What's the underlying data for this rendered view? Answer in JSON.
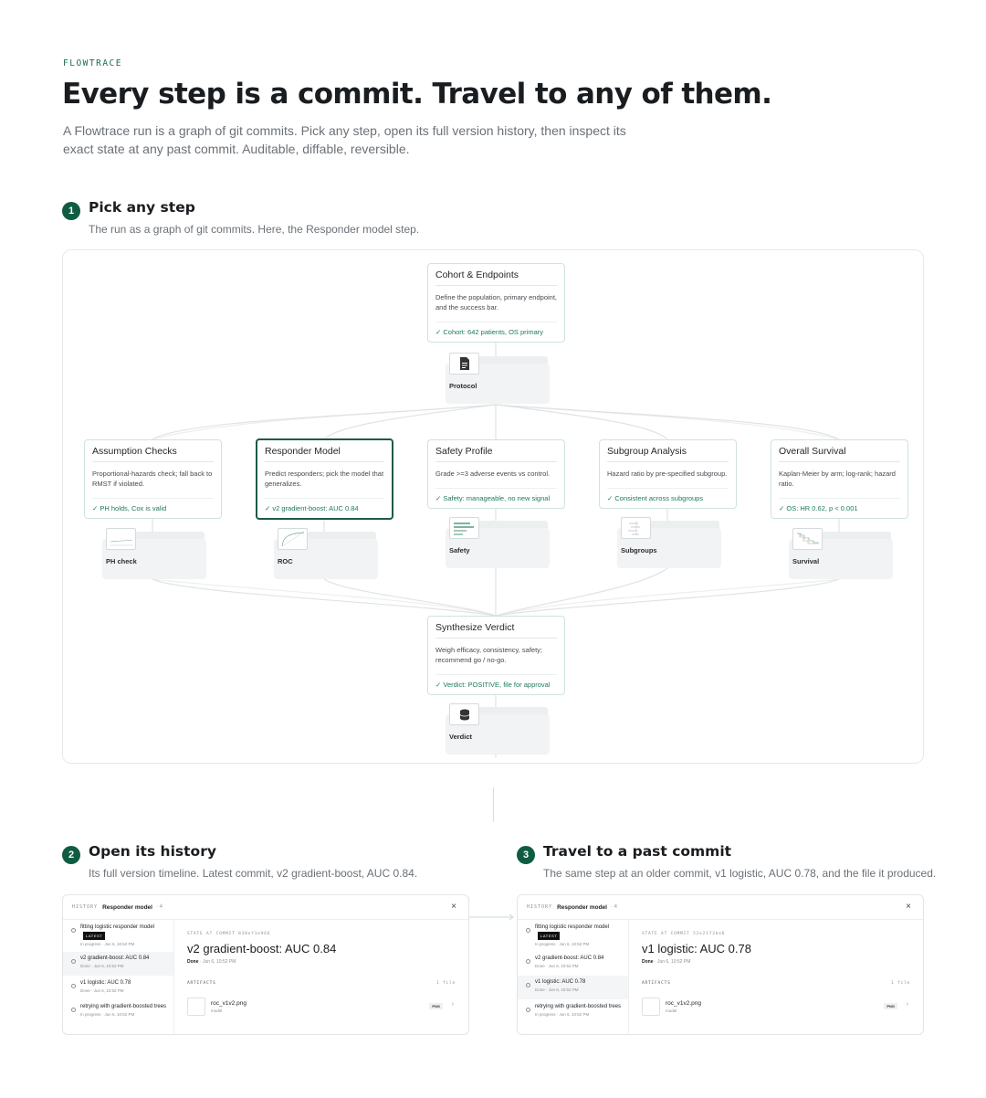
{
  "brand": "FLOWTRACE",
  "hero": {
    "title": "Every step is a commit. Travel to any of them.",
    "subtitle": "A Flowtrace run is a graph of git commits. Pick any step, open its full version history, then inspect its exact state at any past commit. Auditable, diffable, reversible."
  },
  "steps": [
    {
      "num": "1",
      "title": "Pick any step",
      "subtitle": "The run as a graph of git commits. Here, the Responder model step."
    },
    {
      "num": "2",
      "title": "Open its history",
      "subtitle": "Its full version timeline. Latest commit, v2 gradient-boost, AUC 0.84."
    },
    {
      "num": "3",
      "title": "Travel to a past commit",
      "subtitle": "The same step at an older commit, v1 logistic, AUC 0.78, and the file it produced."
    }
  ],
  "graph": {
    "cohort": {
      "title": "Cohort & Endpoints",
      "desc": "Define the population, primary endpoint, and the success bar.",
      "status": "✓ Cohort: 642 patients, OS primary",
      "artifact": "Protocol"
    },
    "branches": [
      {
        "title": "Assumption Checks",
        "desc": "Proportional-hazards check; fall back to RMST if violated.",
        "status": "✓ PH holds, Cox is valid",
        "artifact": "PH check"
      },
      {
        "title": "Responder Model",
        "desc": "Predict responders; pick the model that generalizes.",
        "status": "✓ v2 gradient-boost: AUC 0.84",
        "artifact": "ROC"
      },
      {
        "title": "Safety Profile",
        "desc": "Grade >=3 adverse events vs control.",
        "status": "✓ Safety: manageable, no new signal",
        "artifact": "Safety"
      },
      {
        "title": "Subgroup Analysis",
        "desc": "Hazard ratio by pre-specified subgroup.",
        "status": "✓ Consistent across subgroups",
        "artifact": "Subgroups"
      },
      {
        "title": "Overall Survival",
        "desc": "Kaplan-Meier by arm; log-rank; hazard ratio.",
        "status": "✓ OS: HR 0.62, p < 0.001",
        "artifact": "Survival"
      }
    ],
    "verdict": {
      "title": "Synthesize Verdict",
      "desc": "Weigh efficacy, consistency, safety; recommend go / no-go.",
      "status": "✓ Verdict: POSITIVE, file for approval",
      "artifact": "Verdict"
    }
  },
  "panels": [
    {
      "history_label": "HISTORY",
      "step_name": "Responder model",
      "count": "· 4",
      "close": "×",
      "latest_badge": "LATEST",
      "items": [
        {
          "title": "fitting logistic responder model",
          "meta": "In progress · Jun 6, 10:52 PM"
        },
        {
          "title": "v2 gradient-boost: AUC 0.84",
          "meta": "Done · Jun 6, 10:52 PM"
        },
        {
          "title": "v1 logistic: AUC 0.78",
          "meta": "Done · Jun 6, 10:52 PM"
        },
        {
          "title": "retrying with gradient-boosted trees",
          "meta": "In progress · Jun 6, 10:52 PM"
        }
      ],
      "state_label": "STATE AT COMMIT 830ef1e966",
      "state_title": "v2 gradient-boost: AUC 0.84",
      "state_status": "Done",
      "state_time": "· Jun 6, 10:52 PM",
      "artifacts_label": "ARTIFACTS",
      "artifacts_count": "1 file",
      "file_name": "roc_v1v2.png",
      "file_kind": "model",
      "file_tag": "PNG",
      "chevron": "›"
    },
    {
      "history_label": "HISTORY",
      "step_name": "Responder model",
      "count": "· 4",
      "close": "×",
      "latest_badge": "LATEST",
      "items": [
        {
          "title": "fitting logistic responder model",
          "meta": "In progress · Jun 6, 10:52 PM"
        },
        {
          "title": "v2 gradient-boost: AUC 0.84",
          "meta": "Done · Jun 6, 10:52 PM"
        },
        {
          "title": "v1 logistic: AUC 0.78",
          "meta": "Done · Jun 6, 10:52 PM"
        },
        {
          "title": "retrying with gradient-boosted trees",
          "meta": "In progress · Jun 6, 10:52 PM"
        }
      ],
      "state_label": "STATE AT COMMIT 52e2172be6",
      "state_title": "v1 logistic: AUC 0.78",
      "state_status": "Done",
      "state_time": "· Jun 6, 10:52 PM",
      "artifacts_label": "ARTIFACTS",
      "artifacts_count": "1 file",
      "file_name": "roc_v1v2.png",
      "file_kind": "model",
      "file_tag": "PNG",
      "chevron": "›"
    }
  ],
  "colors": {
    "accent": "#0f5c42",
    "status_green": "#1f7a58",
    "node_border": "#cfe4da"
  }
}
